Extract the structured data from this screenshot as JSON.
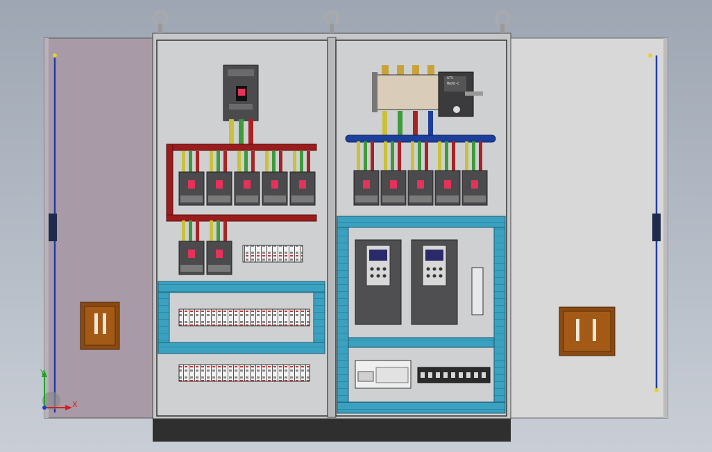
{
  "colors": {
    "background_top": "#9ea6b3",
    "background_bottom": "#c9ced6",
    "left_door": "#a89aa6",
    "right_door": "#d8d8d8",
    "cabinet_frame": "#c6c7c9",
    "mounting_plate": "#cfd0d2",
    "plinth": "#2f2f2f",
    "busbar_red": "#9b1c1c",
    "busbar_blue": "#1d3f9c",
    "cable_duct": "#3aa1c1",
    "handle_brown": "#8a4a12",
    "door_rod": "#1e3ea8",
    "axis_x": "#d81e1e",
    "axis_y": "#1fa32b",
    "axis_z": "#1b3fd6"
  },
  "axes": {
    "x_label": "X",
    "y_label": "Y"
  },
  "device_labels": {
    "ats_label": "MAX8-C",
    "ats_sublabel": "ATS"
  }
}
